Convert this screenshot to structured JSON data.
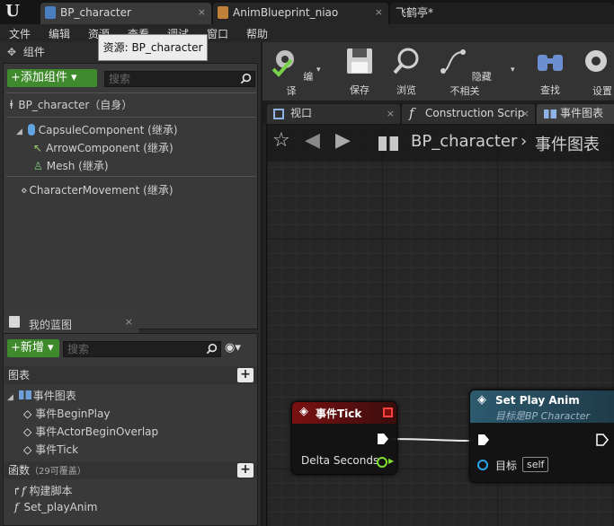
{
  "titlebar": {
    "tabs": [
      {
        "label": "BP_character",
        "close": "×"
      },
      {
        "label": "AnimBlueprint_niao",
        "close": "×"
      },
      {
        "label": "飞鹤亭*"
      }
    ]
  },
  "menu": [
    "文件",
    "编辑",
    "资源",
    "查看",
    "调试",
    "窗口",
    "帮助"
  ],
  "tooltip": "资源: BP_character",
  "components": {
    "title": "组件",
    "add_button": "+添加组件 ▾",
    "search_placeholder": "搜索",
    "root": "BP_character（自身）",
    "items": [
      "CapsuleComponent (继承)",
      "ArrowComponent (继承)",
      "Mesh (继承)",
      "CharacterMovement (继承)"
    ]
  },
  "my_blueprint": {
    "title": "我的蓝图",
    "new_button": "+新增 ▾",
    "search_placeholder": "搜索",
    "graphs_label": "图表",
    "event_graph_label": "事件图表",
    "events": [
      "事件BeginPlay",
      "事件ActorBeginOverlap",
      "事件Tick"
    ],
    "functions_label": "函数",
    "functions_note": "（29可覆盖）",
    "functions": [
      "构建脚本",
      "Set_playAnim"
    ]
  },
  "toolbar": {
    "buttons": [
      "编译",
      "保存",
      "浏览",
      "隐藏不相关",
      "查找",
      "类设置"
    ]
  },
  "editor_tabs": [
    {
      "label": "视口",
      "close": "×"
    },
    {
      "label": "Construction Scrip",
      "close": "×"
    },
    {
      "label": "事件图表"
    }
  ],
  "breadcrumb": {
    "blueprint": "BP_character",
    "separator": "›",
    "graph": "事件图表"
  },
  "nodes": {
    "event_tick": {
      "title": "事件Tick",
      "output_pin": "Delta Seconds"
    },
    "set_play_anim": {
      "title": "Set Play Anim",
      "subtitle": "目标是BP Character",
      "target_label": "目标",
      "target_value": "self"
    }
  },
  "colors": {
    "event_header": "#8a1a1a",
    "function_header": "#2d5a6e",
    "green_button": "#3f8a2c",
    "float_pin": "#7ee02c",
    "object_pin": "#2aa6e8"
  }
}
